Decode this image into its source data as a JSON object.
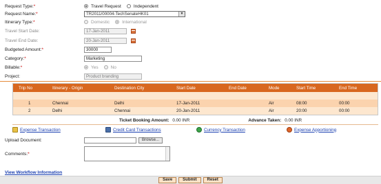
{
  "form": {
    "request_type": {
      "label": "Request Type:",
      "required_mark": "*",
      "options": [
        "Travel Request",
        "Independent"
      ],
      "selected": "Travel Request"
    },
    "request_name": {
      "label": "Request Name:",
      "required_mark": "*",
      "value": "TR2011/00004-TechSenateHK01"
    },
    "itinerary_type": {
      "label": "Itinerary Type:",
      "required_mark": "*",
      "options": [
        "Domestic",
        "International"
      ],
      "selected": "International"
    },
    "travel_start": {
      "label": "Travel Start Date:",
      "value": "17-Jan-2011"
    },
    "travel_end": {
      "label": "Travel End Date:",
      "value": "20-Jan-2011"
    },
    "budgeted_amount": {
      "label": "Budgeted Amount:",
      "required_mark": "*",
      "value": "30000"
    },
    "category": {
      "label": "Category:",
      "required_mark": "*",
      "value": "Marketing"
    },
    "billable": {
      "label": "Billable:",
      "required_mark": "*",
      "options": [
        "Yes",
        "No"
      ],
      "selected": "Yes"
    },
    "project": {
      "label": "Project:",
      "value": "Product branding"
    }
  },
  "grid": {
    "headers": [
      "Trip No",
      "Itinerary - Origin",
      "Destination City",
      "Start Date",
      "End Date",
      "Mode",
      "Start Time",
      "End Time"
    ],
    "rows": [
      [
        "1",
        "Chennai",
        "Delhi",
        "17-Jan-2011",
        "",
        "Air",
        "08:00",
        "00:00"
      ],
      [
        "2",
        "Delhi",
        "Chennai",
        "20-Jan-2011",
        "",
        "Air",
        "20:00",
        "00:00"
      ]
    ]
  },
  "totals": {
    "ticket_label": "Ticket Booking Amount:",
    "ticket_value": "0.00 INR",
    "advance_label": "Advance Taken:",
    "advance_value": "0.00 INR"
  },
  "links": {
    "expense": "Expense Transaction",
    "credit_card": "Credit Card Transactions",
    "currency": "Currency Transaction",
    "apportioning": "Expense Apportioning"
  },
  "upload": {
    "label": "Upload Document:",
    "browse": "Browse..."
  },
  "comments": {
    "label": "Comments:",
    "required_mark": "*"
  },
  "workflow_link": "View Workflow Information",
  "buttons": {
    "save": "Save",
    "submit": "Submit",
    "reset": "Reset"
  },
  "colors": {
    "accent": "#d8671f",
    "row_light": "#fde7cf",
    "row_dark": "#fbd3ae",
    "link": "#1a3fb0"
  }
}
